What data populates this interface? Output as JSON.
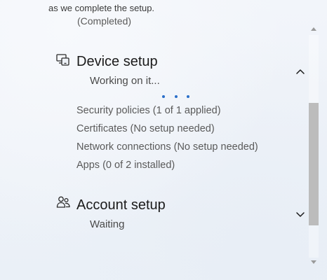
{
  "intro": {
    "text": "as we complete the setup.",
    "previous_status": "(Completed)"
  },
  "device_setup": {
    "title": "Device setup",
    "status": "Working on it...",
    "icon": "devices-icon",
    "expanded": true,
    "items": [
      "Security policies (1 of 1 applied)",
      "Certificates (No setup needed)",
      "Network connections (No setup needed)",
      "Apps (0 of 2 installed)"
    ]
  },
  "account_setup": {
    "title": "Account setup",
    "status": "Waiting",
    "icon": "people-icon",
    "expanded": false
  },
  "scrollbar": {
    "position": 0.68,
    "visible_fraction": 0.55
  },
  "colors": {
    "accent": "#2a6fc9",
    "scroll_thumb": "#bcbcbc",
    "text_primary": "#1b1b1b",
    "text_secondary": "#5a5a5a"
  }
}
